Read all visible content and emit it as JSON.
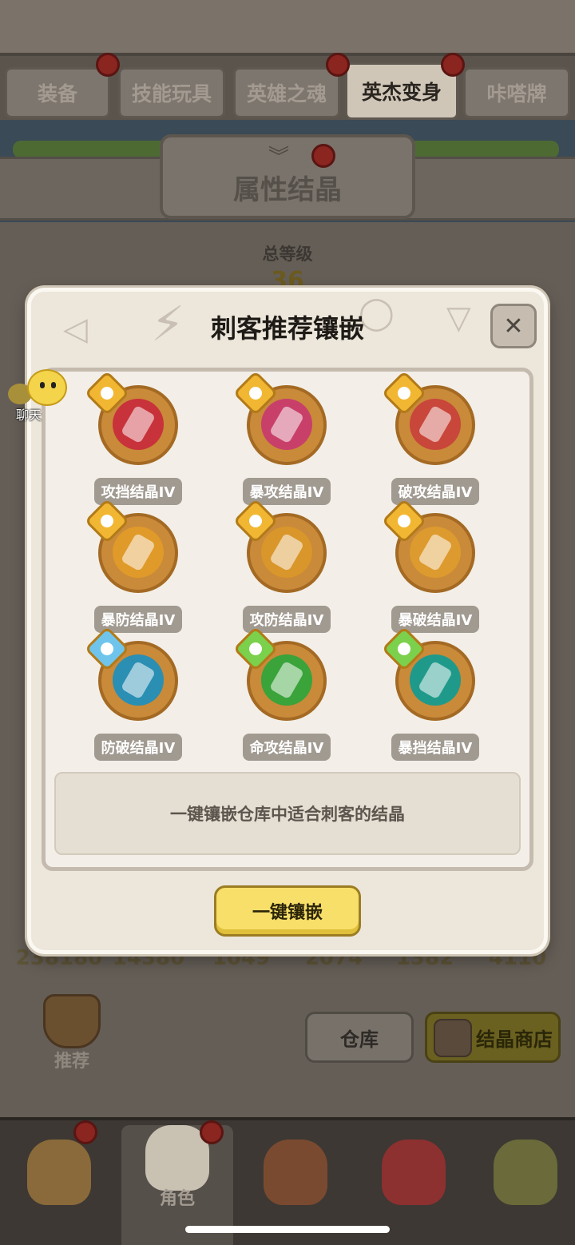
{
  "tabs": [
    {
      "label": "装备",
      "active": false,
      "has_alert": true
    },
    {
      "label": "技能玩具",
      "active": false,
      "has_alert": false
    },
    {
      "label": "英雄之魂",
      "active": false,
      "has_alert": true
    },
    {
      "label": "英杰变身",
      "active": true,
      "has_alert": true
    },
    {
      "label": "咔嗒牌",
      "active": false,
      "has_alert": false
    }
  ],
  "section": {
    "title": "属性结晶",
    "expand_icon": "chevron-down-double-icon"
  },
  "level": {
    "label": "总等级",
    "value": "36"
  },
  "stats": [
    "238180",
    "14380",
    "1049",
    "2074",
    "1382",
    "4110"
  ],
  "chat": {
    "label": "聊天",
    "icon": "chat-bubble-icon"
  },
  "recommend": {
    "label": "推荐",
    "icon": "recommend-emblem-icon"
  },
  "buttons": {
    "warehouse": "仓库",
    "crystal_shop": "结晶商店"
  },
  "bottom_nav": [
    {
      "label": "",
      "icon": "hero-beast-icon",
      "active": false,
      "has_alert": true
    },
    {
      "label": "角色",
      "icon": "hero-character-icon",
      "active": true,
      "has_alert": true
    },
    {
      "label": "",
      "icon": "hero-totem-icon",
      "active": false,
      "has_alert": false
    },
    {
      "label": "",
      "icon": "hero-dragon-icon",
      "active": false,
      "has_alert": false
    },
    {
      "label": "",
      "icon": "hero-tribal-icon",
      "active": false,
      "has_alert": false
    }
  ],
  "modal": {
    "title": "刺客推荐镶嵌",
    "close_icon": "close-icon",
    "crystals": [
      {
        "name": "攻挡结晶IV",
        "color": "#c8323a",
        "badge": "#f1b733"
      },
      {
        "name": "暴攻结晶IV",
        "color": "#c8406a",
        "badge": "#f1b733"
      },
      {
        "name": "破攻结晶IV",
        "color": "#c8463a",
        "badge": "#f1b733"
      },
      {
        "name": "暴防结晶IV",
        "color": "#e09a2a",
        "badge": "#f1b733"
      },
      {
        "name": "攻防结晶IV",
        "color": "#d9962a",
        "badge": "#f1b733"
      },
      {
        "name": "暴破结晶IV",
        "color": "#dd9a2e",
        "badge": "#f1b733"
      },
      {
        "name": "防破结晶IV",
        "color": "#2a8fb3",
        "badge": "#6fc4ec"
      },
      {
        "name": "命攻结晶IV",
        "color": "#3aa33a",
        "badge": "#7bd04c"
      },
      {
        "name": "暴挡结晶IV",
        "color": "#1f9a8a",
        "badge": "#7bd04c"
      }
    ],
    "description": "一键镶嵌仓库中适合刺客的结晶",
    "action_label": "一键镶嵌"
  }
}
